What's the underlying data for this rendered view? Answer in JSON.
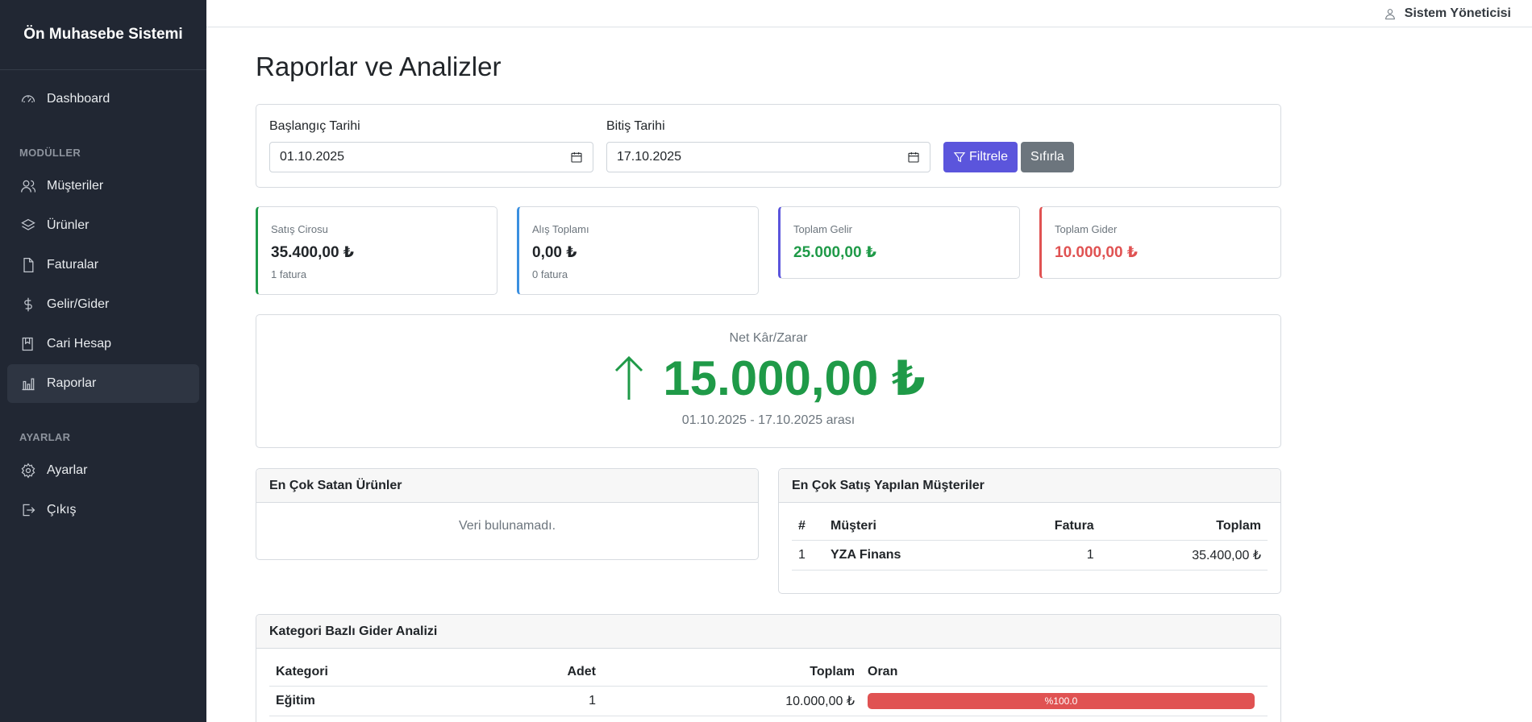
{
  "sidebar": {
    "brand": "Ön Muhasebe Sistemi",
    "dashboard": "Dashboard",
    "section_modules": "MODÜLLER",
    "items": [
      {
        "label": "Müşteriler",
        "icon": "users-icon"
      },
      {
        "label": "Ürünler",
        "icon": "layers-icon"
      },
      {
        "label": "Faturalar",
        "icon": "document-icon"
      },
      {
        "label": "Gelir/Gider",
        "icon": "dollar-icon"
      },
      {
        "label": "Cari Hesap",
        "icon": "book-icon"
      },
      {
        "label": "Raporlar",
        "icon": "chart-bar-icon"
      }
    ],
    "section_settings": "AYARLAR",
    "settings": "Ayarlar",
    "logout": "Çıkış"
  },
  "topbar": {
    "user": "Sistem Yöneticisi"
  },
  "page": {
    "title": "Raporlar ve Analizler"
  },
  "filter": {
    "start_label": "Başlangıç Tarihi",
    "start_value": "01.10.2025",
    "end_label": "Bitiş Tarihi",
    "end_value": "17.10.2025",
    "filter_btn": "Filtrele",
    "reset_btn": "Sıfırla"
  },
  "stats": [
    {
      "label": "Satış Cirosu",
      "value": "35.400,00 ₺",
      "sub": "1 fatura",
      "color": "#212529",
      "border": "#1f9a48"
    },
    {
      "label": "Alış Toplamı",
      "value": "0,00 ₺",
      "sub": "0 fatura",
      "color": "#212529",
      "border": "#3a8fe0"
    },
    {
      "label": "Toplam Gelir",
      "value": "25.000,00 ₺",
      "sub": "",
      "color": "#1f9a48",
      "border": "#5b55dc"
    },
    {
      "label": "Toplam Gider",
      "value": "10.000,00 ₺",
      "sub": "",
      "color": "#e05252",
      "border": "#e05252"
    }
  ],
  "net": {
    "label": "Net Kâr/Zarar",
    "value": "15.000,00 ₺",
    "range": "01.10.2025 - 17.10.2025 arası"
  },
  "top_products": {
    "title": "En Çok Satan Ürünler",
    "empty": "Veri bulunamadı."
  },
  "top_customers": {
    "title": "En Çok Satış Yapılan Müşteriler",
    "headers": [
      "#",
      "Müşteri",
      "Fatura",
      "Toplam"
    ],
    "rows": [
      [
        "1",
        "YZA Finans",
        "1",
        "35.400,00 ₺"
      ]
    ]
  },
  "expense": {
    "title": "Kategori Bazlı Gider Analizi",
    "headers": [
      "Kategori",
      "Adet",
      "Toplam",
      "Oran"
    ],
    "rows": [
      {
        "category": "Eğitim",
        "count": "1",
        "total": "10.000,00 ₺",
        "ratio_label": "%100.0",
        "ratio": 1.0
      }
    ]
  }
}
